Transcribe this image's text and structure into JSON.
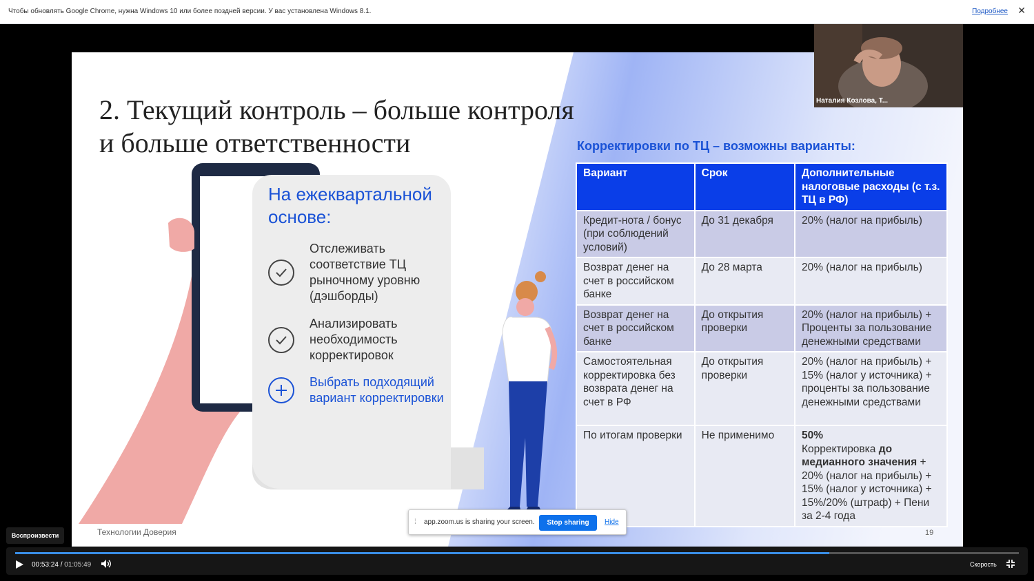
{
  "infobar": {
    "message": "Чтобы обновлять Google Chrome, нужна Windows 10 или более поздней версии. У вас установлена Windows 8.1.",
    "link": "Подробнее",
    "close_icon": "close-icon"
  },
  "slide": {
    "title_line1": "2. Текущий контроль – больше контроля",
    "title_line2": "и больше ответственности",
    "paper_title": "На ежеквартальной основе:",
    "items": [
      {
        "text": "Отслеживать соответствие ТЦ рыночному уровню (дэшборды)",
        "icon": "check-circle-icon"
      },
      {
        "text": "Анализировать необходимость корректировок",
        "icon": "check-circle-icon"
      },
      {
        "text": "Выбрать подходящий вариант корректировки",
        "icon": "plus-circle-icon"
      }
    ],
    "table_title": "Корректировки по ТЦ – возможны варианты:",
    "table": {
      "headers": [
        "Вариант",
        "Срок",
        "Дополнительные налоговые расходы (с т.з. ТЦ в РФ)"
      ],
      "rows": [
        [
          "Кредит-нота / бонус (при соблюдений условий)",
          "До 31 декабря",
          "20% (налог на прибыль)"
        ],
        [
          "Возврат денег на счет в российском банке",
          "До 28 марта",
          "20% (налог на прибыль)"
        ],
        [
          "Возврат денег на счет в российском банке",
          "До открытия проверки",
          "20% (налог на прибыль) + Проценты за пользование денежными средствами"
        ],
        [
          "Самостоятельная корректировка без возврата денег на счет в РФ",
          "До открытия проверки",
          "20% (налог на прибыль) + 15% (налог у источника) + проценты за пользование денежными средствами"
        ]
      ],
      "last_row": {
        "variant": "По итогам проверки",
        "term": "Не применимо",
        "bold1": "50%",
        "plain1": "Корректировка",
        "bold2": "до медианного значения",
        "rest": "+ 20% (налог на прибыль) + 15% (налог у источника) + 15%/20% (штраф) + Пени за 2-4 года"
      }
    },
    "footer": "Технологии Доверия",
    "page_number": "19"
  },
  "webcam": {
    "name": "Наталия Козлова, Т..."
  },
  "share_bar": {
    "text": "app.zoom.us is sharing your screen.",
    "stop_label": "Stop sharing",
    "hide_label": "Hide"
  },
  "player": {
    "tooltip": "Воспроизвести",
    "current_time": "00:53:24",
    "separator": "/",
    "total_time": "01:05:49",
    "progress": 0.811,
    "speed_label": "Скорость"
  },
  "colors": {
    "accent": "#1a52d6",
    "table_header": "#0a3ee8",
    "row_light": "#e8eaf3",
    "row_dark": "#c9cbe6"
  }
}
